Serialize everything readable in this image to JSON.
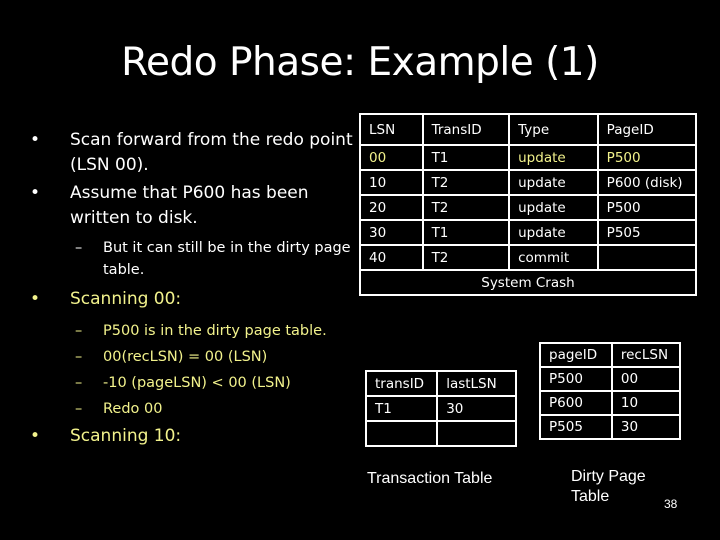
{
  "slide": {
    "title": "Redo Phase: Example (1)",
    "page_number": "38",
    "accent_color": "#f2f28c",
    "bullets": [
      {
        "level": 1,
        "marker": "•",
        "text": "Scan forward from the redo point (LSN 00).",
        "color": "white"
      },
      {
        "level": 1,
        "marker": "•",
        "text": "Assume that P600 has been written to disk.",
        "color": "white"
      },
      {
        "level": 2,
        "marker": "–",
        "text": "But it can still be in the dirty page table.",
        "color": "white"
      },
      {
        "level": 1,
        "marker": "•",
        "text": "Scanning 00:",
        "color": "yellow"
      },
      {
        "level": 2,
        "marker": "–",
        "text": "P500 is in the dirty page table.",
        "color": "yellow"
      },
      {
        "level": 2,
        "marker": "–",
        "text": "00(recLSN) = 00 (LSN)",
        "color": "yellow"
      },
      {
        "level": 2,
        "marker": "–",
        "text": "-10 (pageLSN) < 00 (LSN)",
        "color": "yellow"
      },
      {
        "level": 2,
        "marker": "–",
        "text": "Redo 00",
        "color": "yellow"
      },
      {
        "level": 1,
        "marker": "•",
        "text": "Scanning 10:",
        "color": "yellow"
      }
    ]
  },
  "log_table": {
    "headers": [
      "LSN",
      "TransID",
      "Type",
      "PageID"
    ],
    "rows": [
      {
        "cells": [
          "00",
          "T1",
          "update",
          "P500"
        ],
        "highlight": [
          true,
          false,
          true,
          true
        ]
      },
      {
        "cells": [
          "10",
          "T2",
          "update",
          "P600 (disk)"
        ],
        "highlight": [
          false,
          false,
          false,
          false
        ]
      },
      {
        "cells": [
          "20",
          "T2",
          "update",
          "P500"
        ],
        "highlight": [
          false,
          false,
          false,
          false
        ]
      },
      {
        "cells": [
          "30",
          "T1",
          "update",
          "P505"
        ],
        "highlight": [
          false,
          false,
          false,
          false
        ]
      },
      {
        "cells": [
          "40",
          "T2",
          "commit",
          ""
        ],
        "highlight": [
          false,
          false,
          false,
          false
        ]
      }
    ],
    "footer": "System Crash"
  },
  "transaction_table": {
    "label": "Transaction Table",
    "headers": [
      "transID",
      "lastLSN"
    ],
    "rows": [
      [
        "T1",
        "30"
      ],
      [
        "",
        ""
      ]
    ]
  },
  "dirty_page_table": {
    "label_line1": "Dirty Page",
    "label_line2": "Table",
    "headers": [
      "pageID",
      "recLSN"
    ],
    "rows": [
      [
        "P500",
        "00"
      ],
      [
        "P600",
        "10"
      ],
      [
        "P505",
        "30"
      ]
    ]
  }
}
